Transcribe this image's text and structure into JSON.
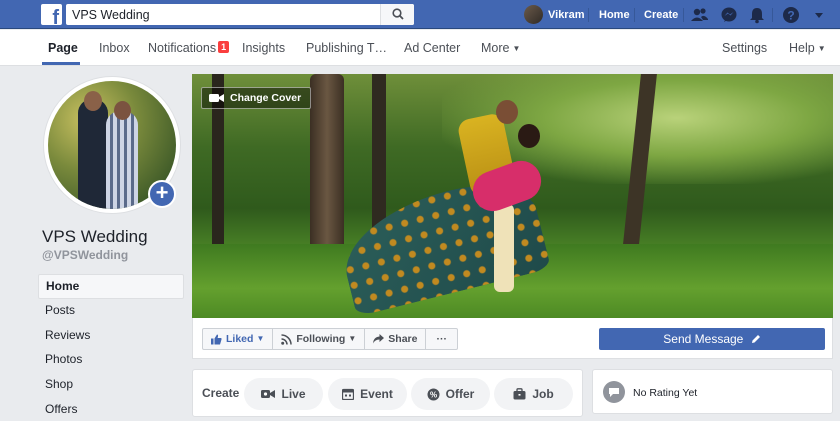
{
  "topbar": {
    "logo": "f",
    "search_value": "VPS Wedding",
    "user_name": "Vikram",
    "home_label": "Home",
    "create_label": "Create",
    "icons": [
      "friends-icon",
      "messenger-icon",
      "notifications-icon",
      "help-icon",
      "dropdown-icon"
    ]
  },
  "tabs": [
    {
      "label": "Page",
      "active": true
    },
    {
      "label": "Inbox"
    },
    {
      "label": "Notifications",
      "badge": "1"
    },
    {
      "label": "Insights"
    },
    {
      "label": "Publishing T…"
    },
    {
      "label": "Ad Center"
    },
    {
      "label": "More"
    },
    {
      "label": "Settings"
    },
    {
      "label": "Help"
    }
  ],
  "page": {
    "name": "VPS Wedding",
    "handle": "@VPSWedding"
  },
  "sidebar": {
    "items": [
      {
        "label": "Home",
        "active": true
      },
      {
        "label": "Posts"
      },
      {
        "label": "Reviews"
      },
      {
        "label": "Photos"
      },
      {
        "label": "Shop"
      },
      {
        "label": "Offers"
      }
    ]
  },
  "cover": {
    "change_label": "Change Cover"
  },
  "actions": {
    "liked": "Liked",
    "following": "Following",
    "share": "Share",
    "more": "···",
    "send_message": "Send Message"
  },
  "create": {
    "label": "Create",
    "pills": [
      "Live",
      "Event",
      "Offer",
      "Job"
    ]
  },
  "rating": {
    "text": "No Rating Yet"
  },
  "colors": {
    "brand": "#4267b2",
    "badge": "#fa3e3e"
  }
}
